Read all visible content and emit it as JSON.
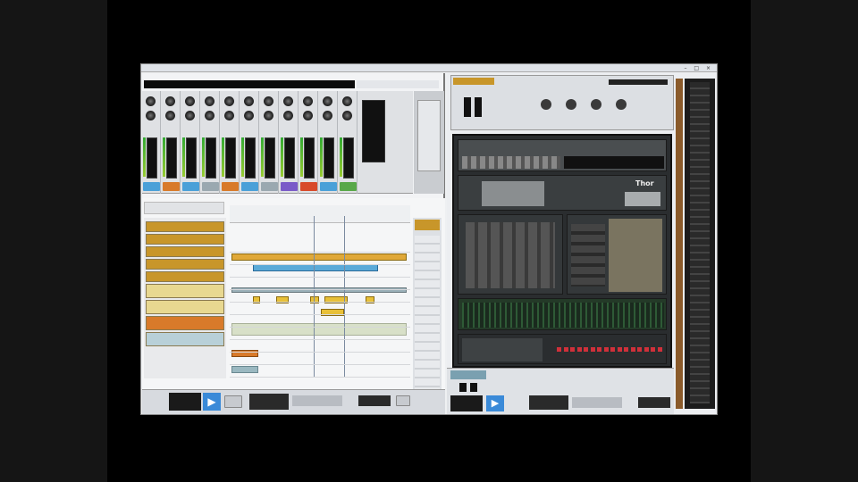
{
  "window": {
    "title": "",
    "controls": "– □ ×"
  },
  "mixer": {
    "channel_colors": [
      "#4aa0d8",
      "#d87a2a",
      "#4aa0d8",
      "#9aa8b0",
      "#d87a2a",
      "#4aa0d8",
      "#9aa8b0",
      "#7a5ac8",
      "#d84a2a",
      "#4aa0d8",
      "#58a848"
    ]
  },
  "sequencer": {
    "tracks": [
      {
        "name": "",
        "color": "#c8962a"
      },
      {
        "name": "",
        "color": "#c8962a"
      },
      {
        "name": "",
        "color": "#c8962a"
      },
      {
        "name": "",
        "color": "#c8962a"
      },
      {
        "name": "",
        "color": "#c8962a"
      },
      {
        "name": "",
        "color": "#e8d890"
      },
      {
        "name": "",
        "color": "#e8d890"
      },
      {
        "name": "",
        "color": "#d87a2a"
      },
      {
        "name": "",
        "color": "#b8d0d8"
      }
    ]
  },
  "rack": {
    "device_label": "Thor",
    "accent": "#c8962a",
    "led_color": "#d0303a"
  },
  "transport": {
    "play_icon": "play-icon",
    "status_color": "#4aa0d8"
  }
}
